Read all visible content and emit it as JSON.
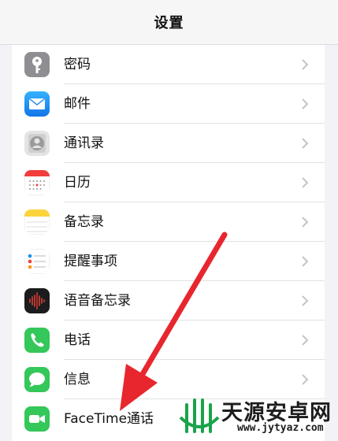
{
  "nav": {
    "title": "设置"
  },
  "settings_items": [
    {
      "label": "密码",
      "icon": "key-icon"
    },
    {
      "label": "邮件",
      "icon": "mail-icon"
    },
    {
      "label": "通讯录",
      "icon": "contacts-icon"
    },
    {
      "label": "日历",
      "icon": "calendar-icon"
    },
    {
      "label": "备忘录",
      "icon": "notes-icon"
    },
    {
      "label": "提醒事项",
      "icon": "reminders-icon"
    },
    {
      "label": "语音备忘录",
      "icon": "voice-memos-icon"
    },
    {
      "label": "电话",
      "icon": "phone-icon"
    },
    {
      "label": "信息",
      "icon": "messages-icon"
    },
    {
      "label": "FaceTime通话",
      "icon": "facetime-icon"
    }
  ],
  "colors": {
    "annotation_arrow": "#e8262e",
    "phone_green": "#34c759",
    "mail_blue": "#1f8ef1"
  },
  "watermark": {
    "text": "天源安卓网",
    "url": "www.jytyaz.com"
  }
}
